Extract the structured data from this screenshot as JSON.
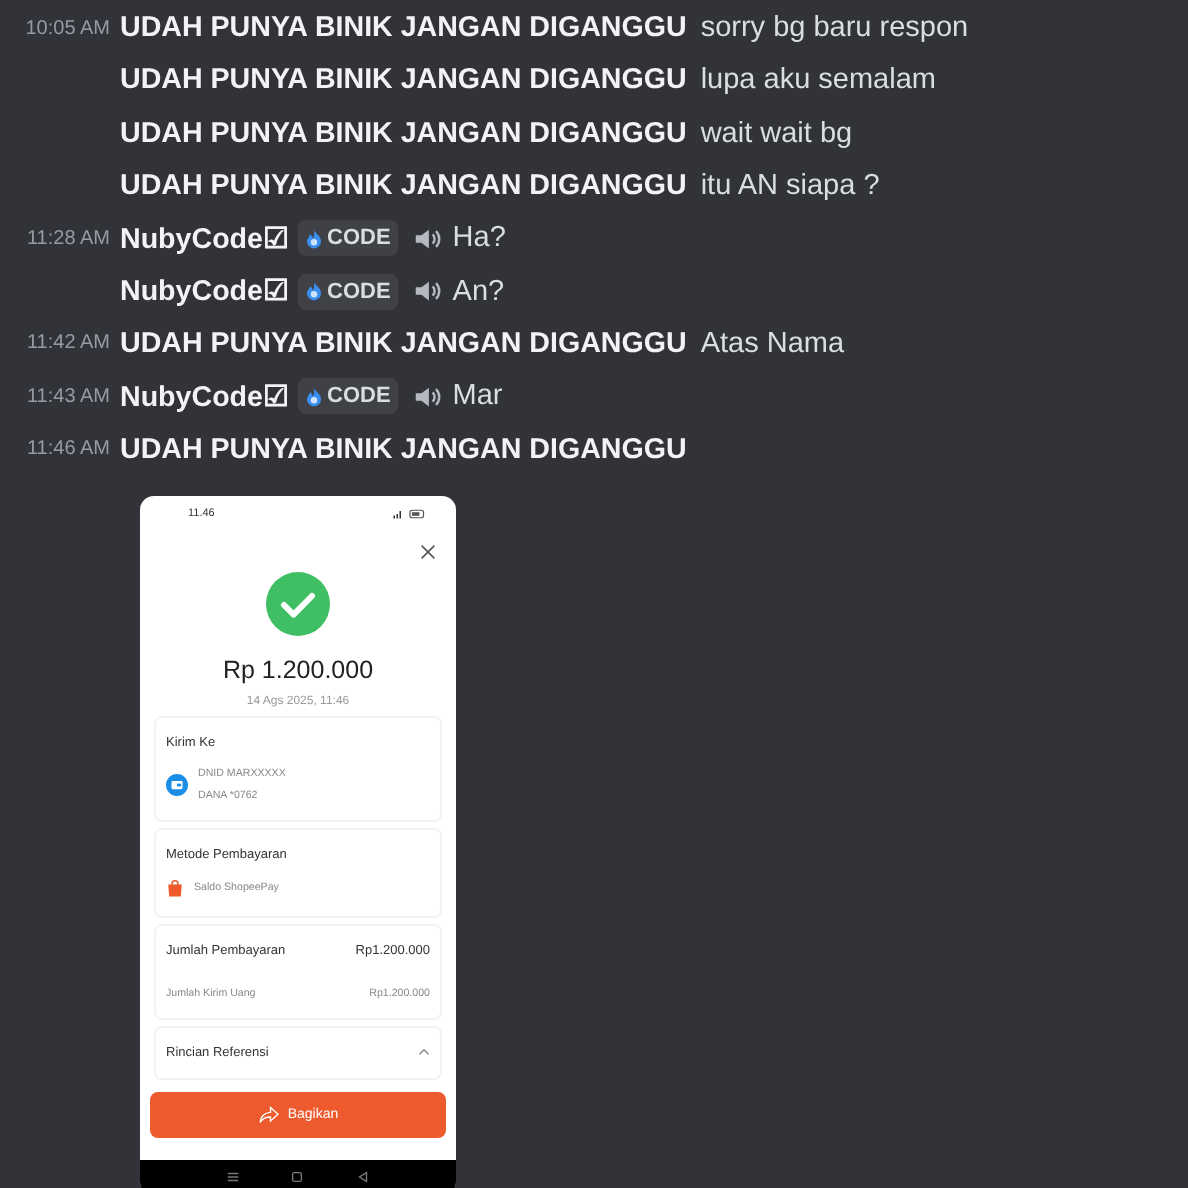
{
  "messages": [
    {
      "time": "10:05 AM",
      "author": "UDAH PUNYA BINIK JANGAN DIGANGGU",
      "text": "sorry bg baru respon"
    },
    {
      "author": "UDAH PUNYA BINIK JANGAN DIGANGGU",
      "text": "lupa aku semalam"
    },
    {
      "author": "UDAH PUNYA BINIK JANGAN DIGANGGU",
      "text": "wait wait bg"
    },
    {
      "author": "UDAH PUNYA BINIK JANGAN DIGANGGU",
      "text": "itu AN siapa ?"
    },
    {
      "time": "11:28 AM",
      "author": "NubyCode☑",
      "tag": "CODE",
      "voice": true,
      "text": "Ha?"
    },
    {
      "author": "NubyCode☑",
      "tag": "CODE",
      "voice": true,
      "text": "An?"
    },
    {
      "time": "11:42 AM",
      "author": "UDAH PUNYA BINIK JANGAN DIGANGGU",
      "text": "Atas Nama"
    },
    {
      "time": "11:43 AM",
      "author": "NubyCode☑",
      "tag": "CODE",
      "voice": true,
      "text": "Mar"
    },
    {
      "time": "11:46 AM",
      "author": "UDAH PUNYA BINIK JANGAN DIGANGGU",
      "attachment": {
        "status_time": "11.46",
        "amount": "Rp 1.200.000",
        "date": "14 Ags 2025, 11:46",
        "sections": [
          {
            "kind": "recipient",
            "title": "Kirim Ke",
            "name": "DNID MARXXXXX",
            "account": "DANA *0762"
          },
          {
            "kind": "method",
            "title": "Metode Pembayaran",
            "method": "Saldo ShopeePay"
          },
          {
            "kind": "amount",
            "title": "Jumlah Pembayaran",
            "value": "Rp1.200.000",
            "detail_label": "Jumlah Kirim Uang",
            "detail_value": "Rp1.200.000"
          },
          {
            "kind": "collapsible",
            "title": "Rincian Referensi",
            "expanded": false
          }
        ],
        "button": "Bagikan"
      }
    }
  ]
}
